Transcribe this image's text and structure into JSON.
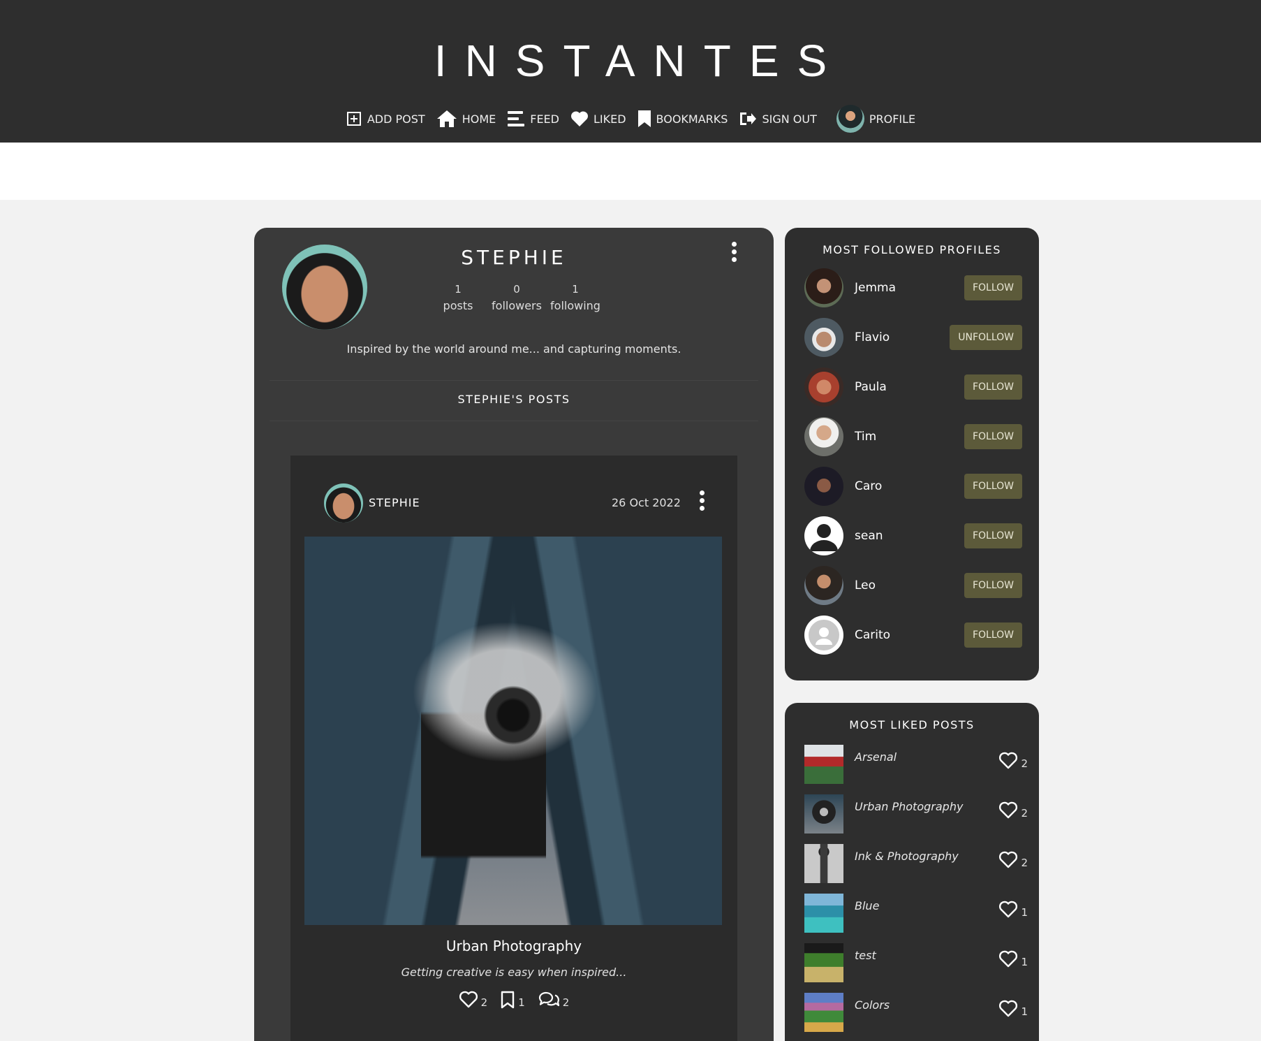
{
  "brand": "INSTANTES",
  "nav": [
    {
      "label": "ADD POST",
      "icon": "plus-square-icon"
    },
    {
      "label": "HOME",
      "icon": "home-icon"
    },
    {
      "label": "FEED",
      "icon": "feed-icon"
    },
    {
      "label": "LIKED",
      "icon": "heart-icon"
    },
    {
      "label": "BOOKMARKS",
      "icon": "bookmark-icon"
    },
    {
      "label": "SIGN OUT",
      "icon": "sign-out-icon"
    },
    {
      "label": "PROFILE",
      "icon": "avatar"
    }
  ],
  "profile": {
    "name": "STEPHIE",
    "stats": [
      {
        "value": "1",
        "label": "posts"
      },
      {
        "value": "0",
        "label": "followers"
      },
      {
        "value": "1",
        "label": "following"
      }
    ],
    "bio": "Inspired by the world around me... and capturing moments.",
    "posts_heading": "STEPHIE'S POSTS"
  },
  "post": {
    "author": "STEPHIE",
    "date": "26 Oct 2022",
    "title": "Urban Photography",
    "caption": "Getting creative is easy when inspired...",
    "likes": "2",
    "bookmarks": "1",
    "comments": "2"
  },
  "most_followed": {
    "heading": "MOST FOLLOWED PROFILES",
    "items": [
      {
        "name": "Jemma",
        "button": "FOLLOW"
      },
      {
        "name": "Flavio",
        "button": "UNFOLLOW"
      },
      {
        "name": "Paula",
        "button": "FOLLOW"
      },
      {
        "name": "Tim",
        "button": "FOLLOW"
      },
      {
        "name": "Caro",
        "button": "FOLLOW"
      },
      {
        "name": "sean",
        "button": "FOLLOW"
      },
      {
        "name": "Leo",
        "button": "FOLLOW"
      },
      {
        "name": "Carito",
        "button": "FOLLOW"
      }
    ]
  },
  "most_liked": {
    "heading": "MOST LIKED POSTS",
    "items": [
      {
        "title": "Arsenal",
        "likes": "2"
      },
      {
        "title": "Urban Photography",
        "likes": "2"
      },
      {
        "title": "Ink & Photography",
        "likes": "2"
      },
      {
        "title": "Blue",
        "likes": "1"
      },
      {
        "title": "test",
        "likes": "1"
      },
      {
        "title": "Colors",
        "likes": "1"
      }
    ]
  },
  "colors": {
    "header_bg": "#2e2e2e",
    "card_bg": "#3a3a3a",
    "button_bg": "#5c5a3a"
  }
}
